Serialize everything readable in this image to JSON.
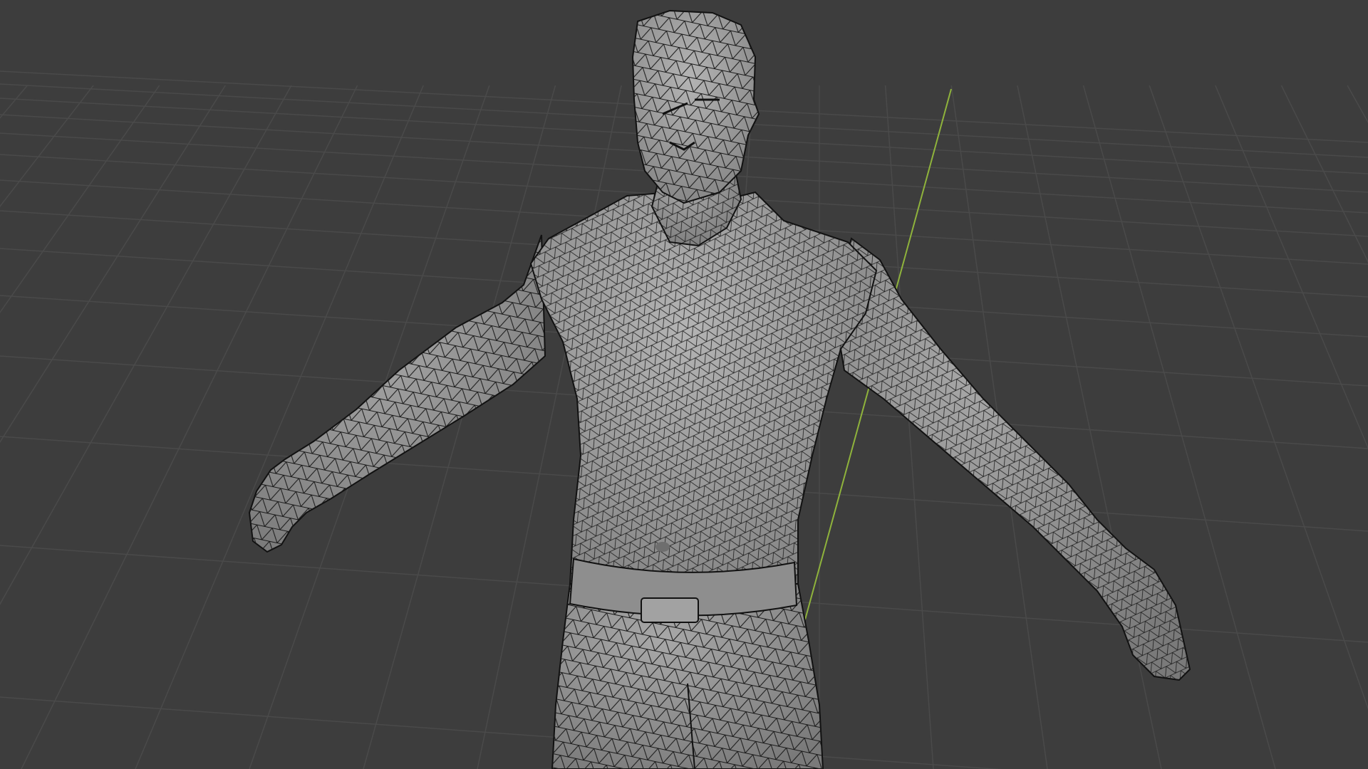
{
  "viewport": {
    "background_color": "#3d3d3d",
    "grid_line_color": "#4a4a4a",
    "y_axis_color": "#8fb33c",
    "mesh_fill_color": "#9a9a9a",
    "mesh_shade_color": "#7c7c7c",
    "wireframe_color": "#141414",
    "shading_mode": "wireframe-over-solid"
  }
}
